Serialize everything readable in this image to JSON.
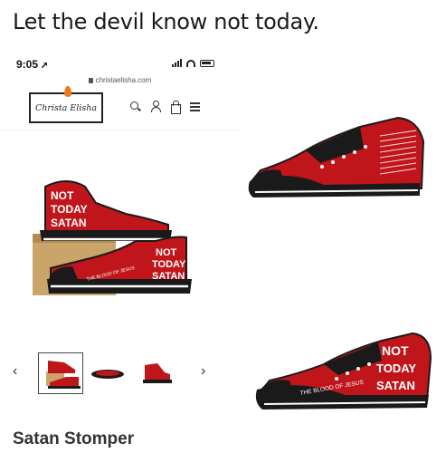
{
  "caption": "Let the devil know not today.",
  "status_bar": {
    "time": "9:05",
    "location_arrow": "➚"
  },
  "browser": {
    "url": "christaelisha.com"
  },
  "header": {
    "logo_text": "Christa Elisha",
    "icons": [
      "search-icon",
      "user-icon",
      "bag-icon",
      "menu-icon"
    ]
  },
  "shoe_text": {
    "lines": [
      "NOT",
      "TODAY",
      "SATAN"
    ],
    "side_text": "THE BLOOD OF JESUS"
  },
  "gallery": {
    "prev": "‹",
    "next": "›"
  },
  "product": {
    "title": "Satan Stomper"
  },
  "colors": {
    "shoe_red": "#c0161b",
    "sole_black": "#1a1a1a",
    "box_kraft": "#c9a56a"
  }
}
